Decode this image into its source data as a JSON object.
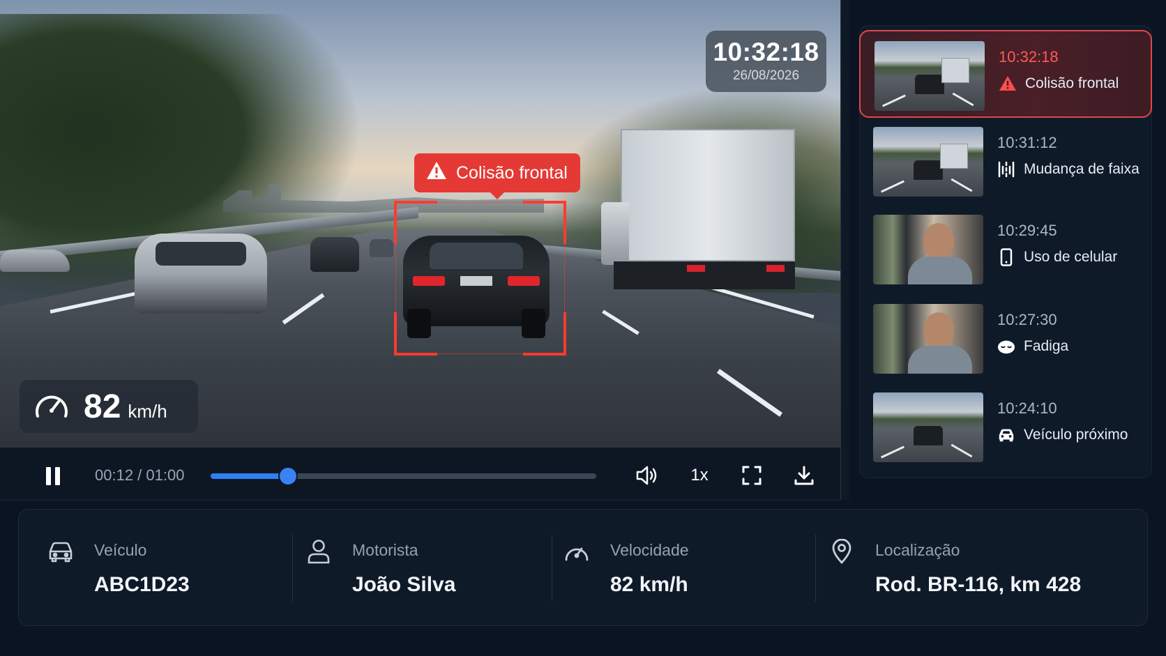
{
  "video": {
    "timestamp_time": "10:32:18",
    "timestamp_date": "26/08/2026",
    "alert_label": "Colisão frontal",
    "speed_value": "82",
    "speed_unit": "km/h"
  },
  "player": {
    "time_display": "00:12 / 01:00",
    "progress_fraction": 0.2,
    "playback_speed": "1x",
    "icons": [
      "pause-icon",
      "volume-icon",
      "fullscreen-icon",
      "download-icon"
    ]
  },
  "events": [
    {
      "time": "10:32:18",
      "label": "Colisão frontal",
      "icon": "warning-icon",
      "thumb": "road",
      "active": true
    },
    {
      "time": "10:31:12",
      "label": "Mudança de faixa",
      "icon": "lane-change-icon",
      "thumb": "road",
      "active": false
    },
    {
      "time": "10:29:45",
      "label": "Uso de celular",
      "icon": "phone-icon",
      "thumb": "cabin",
      "active": false
    },
    {
      "time": "10:27:30",
      "label": "Fadiga",
      "icon": "fatigue-icon",
      "thumb": "cabin",
      "active": false
    },
    {
      "time": "10:24:10",
      "label": "Veículo próximo",
      "icon": "car-icon",
      "thumb": "road",
      "active": false
    }
  ],
  "info": {
    "vehicle": {
      "label": "Veículo",
      "value": "ABC1D23",
      "icon": "car-icon"
    },
    "driver": {
      "label": "Motorista",
      "value": "João Silva",
      "icon": "user-icon"
    },
    "speed": {
      "label": "Velocidade",
      "value": "82 km/h",
      "icon": "speedometer-icon"
    },
    "location": {
      "label": "Localização",
      "value": "Rod. BR-116, km 428",
      "icon": "location-pin-icon"
    }
  },
  "colors": {
    "alert_red": "#e53935",
    "accent_blue": "#2f7ff5",
    "background": "#0b1422",
    "panel": "#0f1a28"
  }
}
